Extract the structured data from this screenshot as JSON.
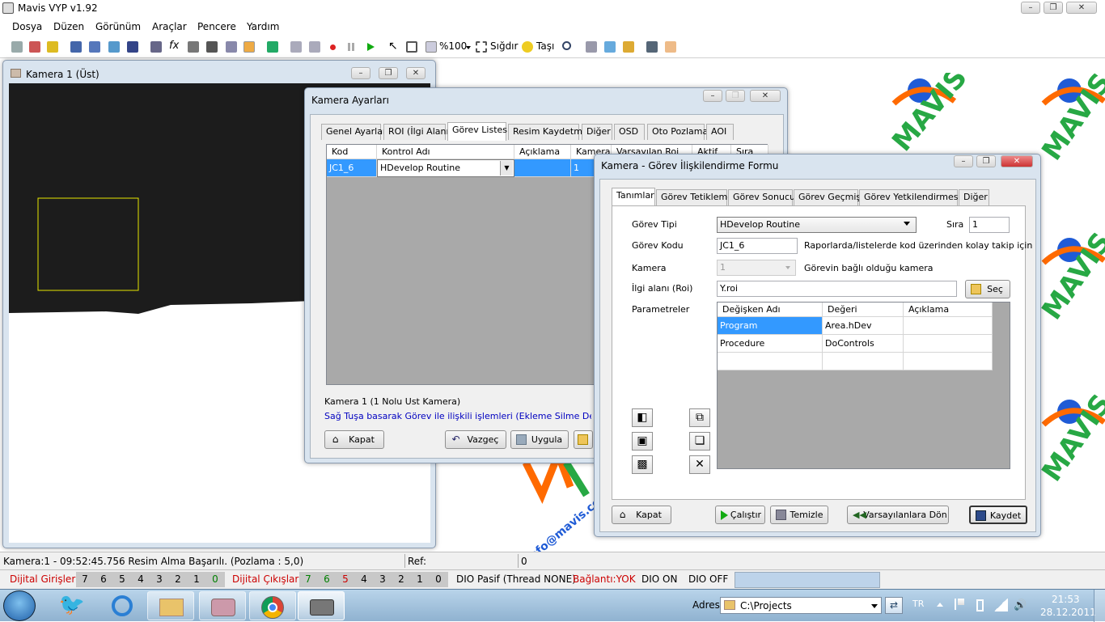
{
  "app": {
    "title": "Mavis VYP v1.92"
  },
  "menu": [
    "Dosya",
    "Düzen",
    "Görünüm",
    "Araçlar",
    "Pencere",
    "Yardım"
  ],
  "toolbar": {
    "zoom_label": "%100",
    "fit_label": "Sığdır",
    "move_label": "Taşı"
  },
  "camera_window": {
    "title": "Kamera 1 (Üst)"
  },
  "settings": {
    "title": "Kamera Ayarları",
    "tabs": [
      "Genel Ayarlar",
      "ROI (İlgi Alanı)",
      "Görev Listesi",
      "Resim Kaydetme",
      "Diğer",
      "OSD",
      "Oto Pozlama",
      "AOI"
    ],
    "columns": [
      "Kod",
      "Kontrol Adı",
      "Açıklama",
      "Kamera",
      "Varsayılan Roi",
      "Aktif",
      "Sıra"
    ],
    "row": {
      "code": "JC1_6",
      "control": "HDevelop Routine",
      "camera": "1"
    },
    "info1": "Kamera 1 (1 Nolu Ust Kamera)",
    "info2": "Sağ Tuşa basarak Görev ile ilişkili işlemleri (Ekleme Silme Değiştirme vb",
    "close_label": "Kapat",
    "cancel_label": "Vazgeç",
    "apply_label": "Uygula"
  },
  "form": {
    "title": "Kamera - Görev İlişkilendirme Formu",
    "tabs": [
      "Tanımlar",
      "Görev Tetikleme",
      "Görev Sonucu",
      "Görev Geçmişi",
      "Görev Yetkilendirmesi",
      "Diğer"
    ],
    "task_type_label": "Görev Tipi",
    "task_type_value": "HDevelop Routine",
    "order_label": "Sıra",
    "order_value": "1",
    "task_code_label": "Görev Kodu",
    "task_code_value": "JC1_6",
    "task_code_hint": "Raporlarda/listelerde kod üzerinden kolay takip  için",
    "camera_label": "Kamera",
    "camera_value": "1",
    "camera_hint": "Görevin bağlı olduğu kamera",
    "roi_label": "İlgi alanı (Roi)",
    "roi_value": "Y.roi",
    "select_label": "Seç",
    "params_label": "Parametreler",
    "param_columns": [
      "Değişken Adı",
      "Değeri",
      "Açıklama"
    ],
    "params": [
      {
        "name": "Program",
        "value": "Area.hDev",
        "desc": ""
      },
      {
        "name": "Procedure",
        "value": "DoControls",
        "desc": ""
      }
    ],
    "close_label": "Kapat",
    "run_label": "Çalıştır",
    "clear_label": "Temizle",
    "defaults_label": "Varsayılanlara Dön",
    "save_label": "Kaydet"
  },
  "logo": {
    "text": "info@mavis.com.tr",
    "brand": "MAVIS"
  },
  "status": {
    "message": "Kamera:1 - 09:52:45.756 Resim Alma Başarılı. (Pozlama : 5,0)",
    "ref_label": "Ref:",
    "ref_value": "0"
  },
  "dio": {
    "inputs_label": "Dijital Girişler :",
    "inputs": [
      "7",
      "6",
      "5",
      "4",
      "3",
      "2",
      "1",
      "0"
    ],
    "outputs_label": "Dijital Çıkışlar :",
    "outputs": [
      "7",
      "6",
      "5",
      "4",
      "3",
      "2",
      "1",
      "0"
    ],
    "state": "DIO Pasif (Thread NONE)",
    "connection": "Bağlantı:YOK",
    "on_label": "DIO ON",
    "off_label": "DIO OFF"
  },
  "taskbar": {
    "address_label": "Adres",
    "address_value": "C:\\Projects",
    "lang": "TR",
    "time": "21:53",
    "date": "28.12.2011"
  },
  "colors": {
    "accent": "#3399ff",
    "error": "#cc0000",
    "ok": "#008000",
    "brand_orange": "#ff6a00",
    "brand_green": "#27a844",
    "brand_blue": "#1f5bd6"
  }
}
